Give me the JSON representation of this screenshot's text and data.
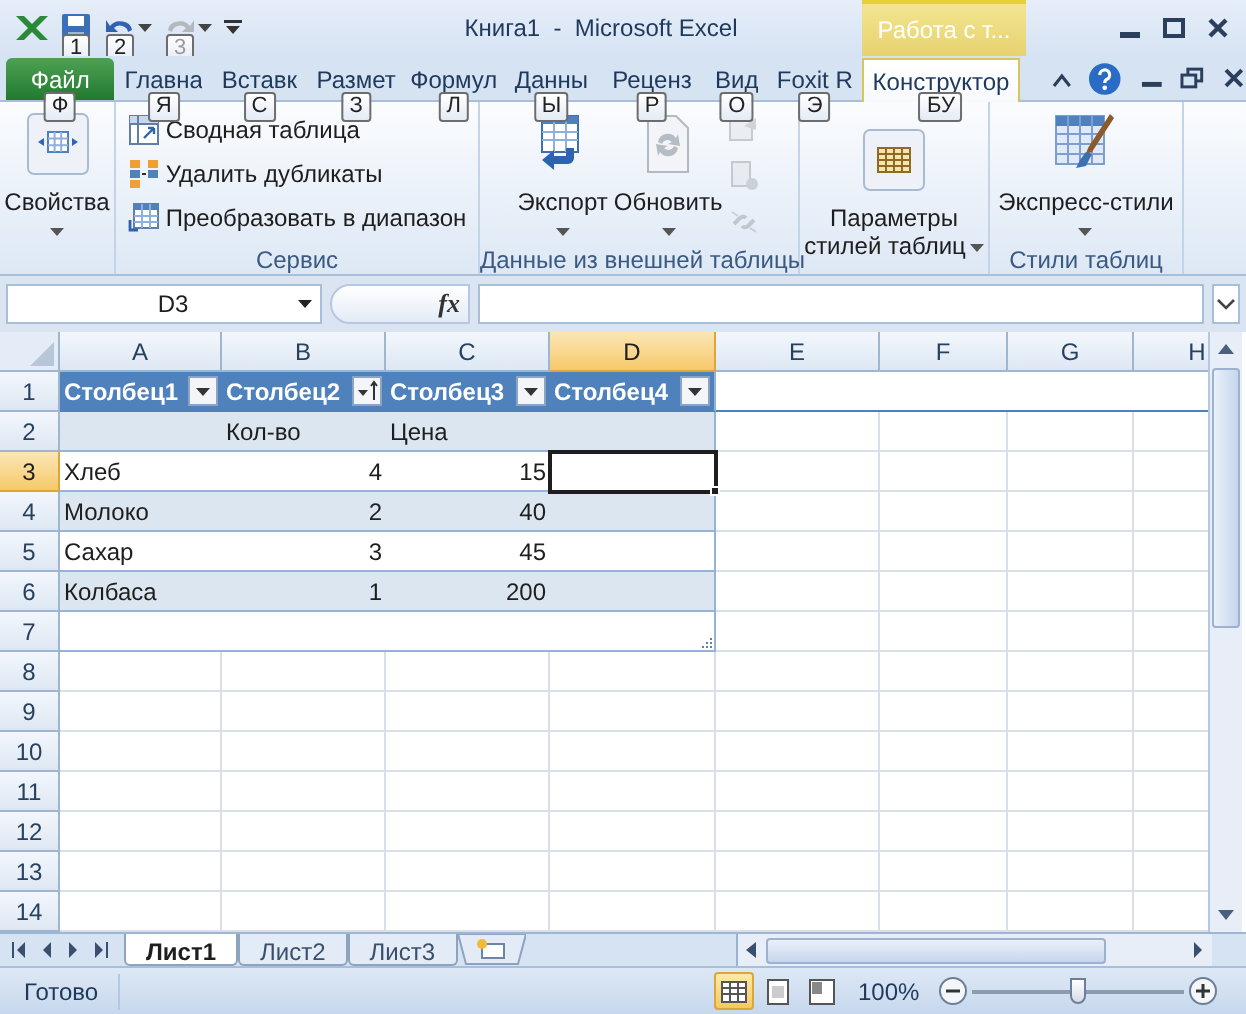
{
  "window": {
    "title": "Книга1  -  Microsoft Excel",
    "contextual_title": "Работа с т..."
  },
  "quick_access": [
    {
      "keytip": "1",
      "disabled": false
    },
    {
      "keytip": "2",
      "disabled": false
    },
    {
      "keytip": "3",
      "disabled": true
    }
  ],
  "tabs": [
    {
      "label": "Файл",
      "keytip": "Ф",
      "selected": false,
      "kind": "file"
    },
    {
      "label": "Главна",
      "keytip": "Я",
      "selected": false,
      "kind": "normal"
    },
    {
      "label": "Вставк",
      "keytip": "С",
      "selected": false,
      "kind": "normal"
    },
    {
      "label": "Размет",
      "keytip": "З",
      "selected": false,
      "kind": "normal"
    },
    {
      "label": "Формул",
      "keytip": "Л",
      "selected": false,
      "kind": "normal"
    },
    {
      "label": "Данны",
      "keytip": "Ы",
      "selected": false,
      "kind": "normal"
    },
    {
      "label": "Реценз",
      "keytip": "Р",
      "selected": false,
      "kind": "normal"
    },
    {
      "label": "Вид",
      "keytip": "О",
      "selected": false,
      "kind": "normal"
    },
    {
      "label": "Foxit R",
      "keytip": "Э",
      "selected": false,
      "kind": "normal"
    },
    {
      "label": "Конструктор",
      "keytip": "БУ",
      "selected": true,
      "kind": "contextual"
    }
  ],
  "ribbon": {
    "groups": [
      {
        "buttons": [
          {
            "kind": "large",
            "label": "Свойства"
          }
        ]
      },
      {
        "label": "Сервис",
        "buttons": [
          {
            "kind": "small",
            "label": "Сводная таблица"
          },
          {
            "kind": "small",
            "label": "Удалить дубликаты"
          },
          {
            "kind": "small",
            "label": "Преобразовать в диапазон"
          }
        ]
      },
      {
        "label": "Данные из внешней таблицы",
        "buttons": [
          {
            "kind": "large",
            "label": "Экспорт"
          },
          {
            "kind": "large",
            "label": "Обновить"
          },
          {
            "kind": "icon",
            "disabled": true
          },
          {
            "kind": "icon",
            "disabled": true
          },
          {
            "kind": "icon",
            "disabled": true
          }
        ]
      },
      {
        "buttons": [
          {
            "kind": "large",
            "label": "Параметры стилей таблиц"
          }
        ]
      },
      {
        "label": "Стили таблиц",
        "buttons": [
          {
            "kind": "large",
            "label": "Экспресс-стили"
          }
        ]
      }
    ]
  },
  "formula_bar": {
    "name_box": "D3",
    "function_label": "fx"
  },
  "grid": {
    "columns": [
      {
        "label": "A",
        "selected": false
      },
      {
        "label": "B",
        "selected": false
      },
      {
        "label": "C",
        "selected": false
      },
      {
        "label": "D",
        "selected": true
      },
      {
        "label": "E",
        "selected": false
      },
      {
        "label": "F",
        "selected": false
      },
      {
        "label": "G",
        "selected": false
      },
      {
        "label": "H",
        "selected": false
      }
    ],
    "rows": [
      {
        "label": "1",
        "selected": false,
        "kind": "table_header",
        "cells": [
          {
            "kind": "header",
            "text": "Столбец1",
            "sorted": false,
            "selected": false
          },
          {
            "kind": "header",
            "text": "Столбец2",
            "sorted": true,
            "selected": false
          },
          {
            "kind": "header",
            "text": "Столбец3",
            "sorted": false,
            "selected": false
          },
          {
            "kind": "header",
            "text": "Столбец4",
            "sorted": false,
            "selected": false
          }
        ]
      },
      {
        "label": "2",
        "selected": false,
        "kind": "table_band",
        "cells": [
          {
            "kind": "empty",
            "selected": false
          },
          {
            "kind": "text",
            "text": "Кол-во",
            "selected": false
          },
          {
            "kind": "text",
            "text": "Цена",
            "selected": false
          },
          {
            "kind": "empty",
            "selected": false
          }
        ]
      },
      {
        "label": "3",
        "selected": true,
        "kind": "table_plain",
        "cells": [
          {
            "kind": "text",
            "text": "Хлеб",
            "selected": false
          },
          {
            "kind": "number",
            "text": "4",
            "selected": false
          },
          {
            "kind": "number",
            "text": "15",
            "selected": false
          },
          {
            "kind": "empty",
            "selected": true
          }
        ]
      },
      {
        "label": "4",
        "selected": false,
        "kind": "table_band",
        "cells": [
          {
            "kind": "text",
            "text": "Молоко",
            "selected": false
          },
          {
            "kind": "number",
            "text": "2",
            "selected": false
          },
          {
            "kind": "number",
            "text": "40",
            "selected": false
          },
          {
            "kind": "empty",
            "selected": false
          }
        ]
      },
      {
        "label": "5",
        "selected": false,
        "kind": "table_plain",
        "cells": [
          {
            "kind": "text",
            "text": "Сахар",
            "selected": false
          },
          {
            "kind": "number",
            "text": "3",
            "selected": false
          },
          {
            "kind": "number",
            "text": "45",
            "selected": false
          },
          {
            "kind": "empty",
            "selected": false
          }
        ]
      },
      {
        "label": "6",
        "selected": false,
        "kind": "table_band",
        "cells": [
          {
            "kind": "text",
            "text": "Колбаса",
            "selected": false
          },
          {
            "kind": "number",
            "text": "1",
            "selected": false
          },
          {
            "kind": "number",
            "text": "200",
            "selected": false
          },
          {
            "kind": "empty",
            "selected": false
          }
        ]
      },
      {
        "label": "7",
        "selected": false,
        "kind": "table_plain",
        "cells": [
          {
            "kind": "empty",
            "selected": false
          },
          {
            "kind": "empty",
            "selected": false
          },
          {
            "kind": "empty",
            "selected": false
          },
          {
            "kind": "empty",
            "selected": false,
            "resize_handle": true
          }
        ]
      },
      {
        "label": "8",
        "selected": false,
        "kind": "sheet"
      },
      {
        "label": "9",
        "selected": false,
        "kind": "sheet"
      },
      {
        "label": "10",
        "selected": false,
        "kind": "sheet"
      },
      {
        "label": "11",
        "selected": false,
        "kind": "sheet"
      },
      {
        "label": "12",
        "selected": false,
        "kind": "sheet"
      },
      {
        "label": "13",
        "selected": false,
        "kind": "sheet"
      },
      {
        "label": "14",
        "selected": false,
        "kind": "sheet"
      }
    ]
  },
  "sheets": [
    {
      "label": "Лист1",
      "selected": true
    },
    {
      "label": "Лист2",
      "selected": false
    },
    {
      "label": "Лист3",
      "selected": false
    }
  ],
  "status_bar": {
    "text": "Готово",
    "views": [
      {
        "selected": true
      },
      {
        "selected": false
      },
      {
        "selected": false
      }
    ],
    "zoom": "100%",
    "zoom_slider": {
      "level": 0.5
    }
  }
}
